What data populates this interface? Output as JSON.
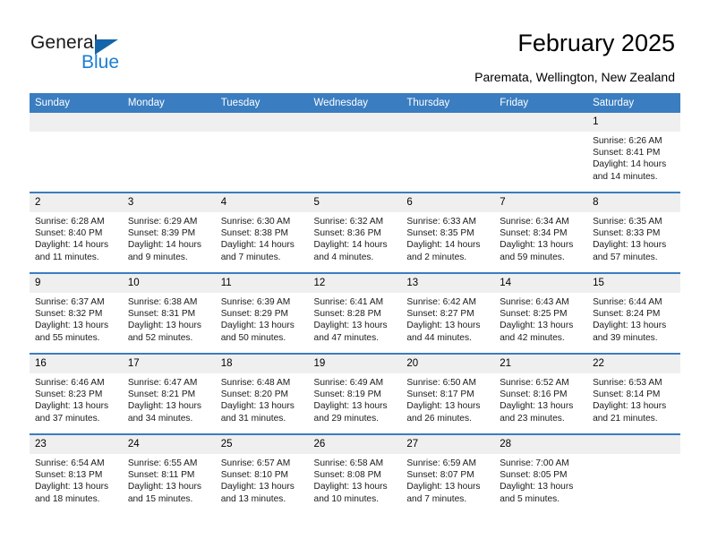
{
  "brand": {
    "name_primary": "General",
    "name_secondary": "Blue",
    "triangle_icon": "triangle-icon",
    "accent_color": "#1464aa",
    "secondary_color": "#1a7fd4"
  },
  "header": {
    "title": "February 2025",
    "subtitle": "Paremata, Wellington, New Zealand"
  },
  "calendar": {
    "header_bg_color": "#3a7dc0",
    "daynum_bg_color": "#efefef",
    "weekday_headers": [
      "Sunday",
      "Monday",
      "Tuesday",
      "Wednesday",
      "Thursday",
      "Friday",
      "Saturday"
    ],
    "weeks": [
      [
        {
          "day": "",
          "sunrise": "",
          "sunset": "",
          "daylight": ""
        },
        {
          "day": "",
          "sunrise": "",
          "sunset": "",
          "daylight": ""
        },
        {
          "day": "",
          "sunrise": "",
          "sunset": "",
          "daylight": ""
        },
        {
          "day": "",
          "sunrise": "",
          "sunset": "",
          "daylight": ""
        },
        {
          "day": "",
          "sunrise": "",
          "sunset": "",
          "daylight": ""
        },
        {
          "day": "",
          "sunrise": "",
          "sunset": "",
          "daylight": ""
        },
        {
          "day": "1",
          "sunrise": "Sunrise: 6:26 AM",
          "sunset": "Sunset: 8:41 PM",
          "daylight": "Daylight: 14 hours and 14 minutes."
        }
      ],
      [
        {
          "day": "2",
          "sunrise": "Sunrise: 6:28 AM",
          "sunset": "Sunset: 8:40 PM",
          "daylight": "Daylight: 14 hours and 11 minutes."
        },
        {
          "day": "3",
          "sunrise": "Sunrise: 6:29 AM",
          "sunset": "Sunset: 8:39 PM",
          "daylight": "Daylight: 14 hours and 9 minutes."
        },
        {
          "day": "4",
          "sunrise": "Sunrise: 6:30 AM",
          "sunset": "Sunset: 8:38 PM",
          "daylight": "Daylight: 14 hours and 7 minutes."
        },
        {
          "day": "5",
          "sunrise": "Sunrise: 6:32 AM",
          "sunset": "Sunset: 8:36 PM",
          "daylight": "Daylight: 14 hours and 4 minutes."
        },
        {
          "day": "6",
          "sunrise": "Sunrise: 6:33 AM",
          "sunset": "Sunset: 8:35 PM",
          "daylight": "Daylight: 14 hours and 2 minutes."
        },
        {
          "day": "7",
          "sunrise": "Sunrise: 6:34 AM",
          "sunset": "Sunset: 8:34 PM",
          "daylight": "Daylight: 13 hours and 59 minutes."
        },
        {
          "day": "8",
          "sunrise": "Sunrise: 6:35 AM",
          "sunset": "Sunset: 8:33 PM",
          "daylight": "Daylight: 13 hours and 57 minutes."
        }
      ],
      [
        {
          "day": "9",
          "sunrise": "Sunrise: 6:37 AM",
          "sunset": "Sunset: 8:32 PM",
          "daylight": "Daylight: 13 hours and 55 minutes."
        },
        {
          "day": "10",
          "sunrise": "Sunrise: 6:38 AM",
          "sunset": "Sunset: 8:31 PM",
          "daylight": "Daylight: 13 hours and 52 minutes."
        },
        {
          "day": "11",
          "sunrise": "Sunrise: 6:39 AM",
          "sunset": "Sunset: 8:29 PM",
          "daylight": "Daylight: 13 hours and 50 minutes."
        },
        {
          "day": "12",
          "sunrise": "Sunrise: 6:41 AM",
          "sunset": "Sunset: 8:28 PM",
          "daylight": "Daylight: 13 hours and 47 minutes."
        },
        {
          "day": "13",
          "sunrise": "Sunrise: 6:42 AM",
          "sunset": "Sunset: 8:27 PM",
          "daylight": "Daylight: 13 hours and 44 minutes."
        },
        {
          "day": "14",
          "sunrise": "Sunrise: 6:43 AM",
          "sunset": "Sunset: 8:25 PM",
          "daylight": "Daylight: 13 hours and 42 minutes."
        },
        {
          "day": "15",
          "sunrise": "Sunrise: 6:44 AM",
          "sunset": "Sunset: 8:24 PM",
          "daylight": "Daylight: 13 hours and 39 minutes."
        }
      ],
      [
        {
          "day": "16",
          "sunrise": "Sunrise: 6:46 AM",
          "sunset": "Sunset: 8:23 PM",
          "daylight": "Daylight: 13 hours and 37 minutes."
        },
        {
          "day": "17",
          "sunrise": "Sunrise: 6:47 AM",
          "sunset": "Sunset: 8:21 PM",
          "daylight": "Daylight: 13 hours and 34 minutes."
        },
        {
          "day": "18",
          "sunrise": "Sunrise: 6:48 AM",
          "sunset": "Sunset: 8:20 PM",
          "daylight": "Daylight: 13 hours and 31 minutes."
        },
        {
          "day": "19",
          "sunrise": "Sunrise: 6:49 AM",
          "sunset": "Sunset: 8:19 PM",
          "daylight": "Daylight: 13 hours and 29 minutes."
        },
        {
          "day": "20",
          "sunrise": "Sunrise: 6:50 AM",
          "sunset": "Sunset: 8:17 PM",
          "daylight": "Daylight: 13 hours and 26 minutes."
        },
        {
          "day": "21",
          "sunrise": "Sunrise: 6:52 AM",
          "sunset": "Sunset: 8:16 PM",
          "daylight": "Daylight: 13 hours and 23 minutes."
        },
        {
          "day": "22",
          "sunrise": "Sunrise: 6:53 AM",
          "sunset": "Sunset: 8:14 PM",
          "daylight": "Daylight: 13 hours and 21 minutes."
        }
      ],
      [
        {
          "day": "23",
          "sunrise": "Sunrise: 6:54 AM",
          "sunset": "Sunset: 8:13 PM",
          "daylight": "Daylight: 13 hours and 18 minutes."
        },
        {
          "day": "24",
          "sunrise": "Sunrise: 6:55 AM",
          "sunset": "Sunset: 8:11 PM",
          "daylight": "Daylight: 13 hours and 15 minutes."
        },
        {
          "day": "25",
          "sunrise": "Sunrise: 6:57 AM",
          "sunset": "Sunset: 8:10 PM",
          "daylight": "Daylight: 13 hours and 13 minutes."
        },
        {
          "day": "26",
          "sunrise": "Sunrise: 6:58 AM",
          "sunset": "Sunset: 8:08 PM",
          "daylight": "Daylight: 13 hours and 10 minutes."
        },
        {
          "day": "27",
          "sunrise": "Sunrise: 6:59 AM",
          "sunset": "Sunset: 8:07 PM",
          "daylight": "Daylight: 13 hours and 7 minutes."
        },
        {
          "day": "28",
          "sunrise": "Sunrise: 7:00 AM",
          "sunset": "Sunset: 8:05 PM",
          "daylight": "Daylight: 13 hours and 5 minutes."
        },
        {
          "day": "",
          "sunrise": "",
          "sunset": "",
          "daylight": ""
        }
      ]
    ]
  }
}
